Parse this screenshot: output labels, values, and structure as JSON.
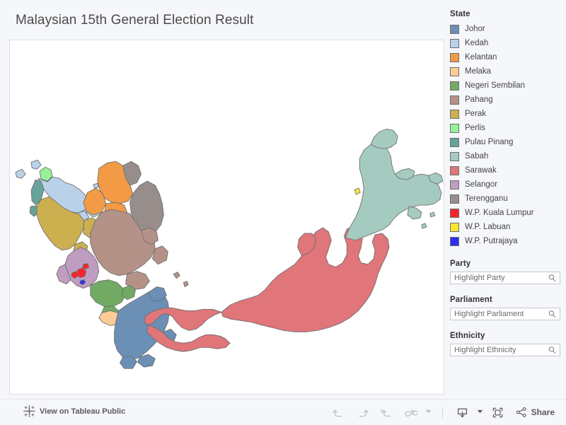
{
  "dashboard": {
    "title": "Malaysian 15th General Election Result"
  },
  "legend": {
    "heading": "State",
    "items": [
      {
        "label": "Johor",
        "color": "#6b8fb5"
      },
      {
        "label": "Kedah",
        "color": "#b9d2e8"
      },
      {
        "label": "Kelantan",
        "color": "#f29a45"
      },
      {
        "label": "Melaka",
        "color": "#fdcb96"
      },
      {
        "label": "Negeri Sembilan",
        "color": "#72aa63"
      },
      {
        "label": "Pahang",
        "color": "#b59288"
      },
      {
        "label": "Perak",
        "color": "#ccb04f"
      },
      {
        "label": "Perlis",
        "color": "#96f195"
      },
      {
        "label": "Pulau Pinang",
        "color": "#65a39b"
      },
      {
        "label": "Sabah",
        "color": "#a5cbc1"
      },
      {
        "label": "Sarawak",
        "color": "#e0757a"
      },
      {
        "label": "Selangor",
        "color": "#bf9dc0"
      },
      {
        "label": "Terengganu",
        "color": "#978e8c"
      },
      {
        "label": "W.P. Kuala Lumpur",
        "color": "#fa2329"
      },
      {
        "label": "W.P. Labuan",
        "color": "#f9e534"
      },
      {
        "label": "W.P. Putrajaya",
        "color": "#2d2ef0"
      }
    ]
  },
  "filters": [
    {
      "heading": "Party",
      "placeholder": "Highlight Party",
      "value": ""
    },
    {
      "heading": "Parliament",
      "placeholder": "Highlight Parliament",
      "value": ""
    },
    {
      "heading": "Ethnicity",
      "placeholder": "Highlight Ethnicity",
      "value": ""
    }
  ],
  "toolbar": {
    "tableau_link_label": "View on Tableau Public",
    "share_label": "Share",
    "buttons": [
      {
        "name": "undo",
        "icon": "undo-icon"
      },
      {
        "name": "redo",
        "icon": "redo-icon"
      },
      {
        "name": "revert",
        "icon": "revert-icon"
      },
      {
        "name": "refresh",
        "icon": "refresh-icon"
      },
      {
        "name": "pause",
        "icon": "chevron-down-icon"
      },
      {
        "name": "download",
        "icon": "download-icon"
      },
      {
        "name": "fullscreen",
        "icon": "fullscreen-icon"
      }
    ]
  },
  "map": {
    "background": "#ffffff",
    "border_color": "#7a7a7a",
    "regions": [
      {
        "state": "Perlis",
        "color": "#96f195"
      },
      {
        "state": "Kedah",
        "color": "#b9d2e8"
      },
      {
        "state": "Pulau Pinang",
        "color": "#65a39b"
      },
      {
        "state": "Perak",
        "color": "#ccb04f"
      },
      {
        "state": "Kelantan",
        "color": "#f29a45"
      },
      {
        "state": "Terengganu",
        "color": "#978e8c"
      },
      {
        "state": "Pahang",
        "color": "#b59288"
      },
      {
        "state": "Selangor",
        "color": "#bf9dc0"
      },
      {
        "state": "W.P. Kuala Lumpur",
        "color": "#fa2329"
      },
      {
        "state": "W.P. Putrajaya",
        "color": "#2d2ef0"
      },
      {
        "state": "Negeri Sembilan",
        "color": "#72aa63"
      },
      {
        "state": "Melaka",
        "color": "#fdcb96"
      },
      {
        "state": "Johor",
        "color": "#6b8fb5"
      },
      {
        "state": "Sarawak",
        "color": "#e0757a"
      },
      {
        "state": "Sabah",
        "color": "#a5cbc1"
      },
      {
        "state": "W.P. Labuan",
        "color": "#f9e534"
      }
    ]
  }
}
